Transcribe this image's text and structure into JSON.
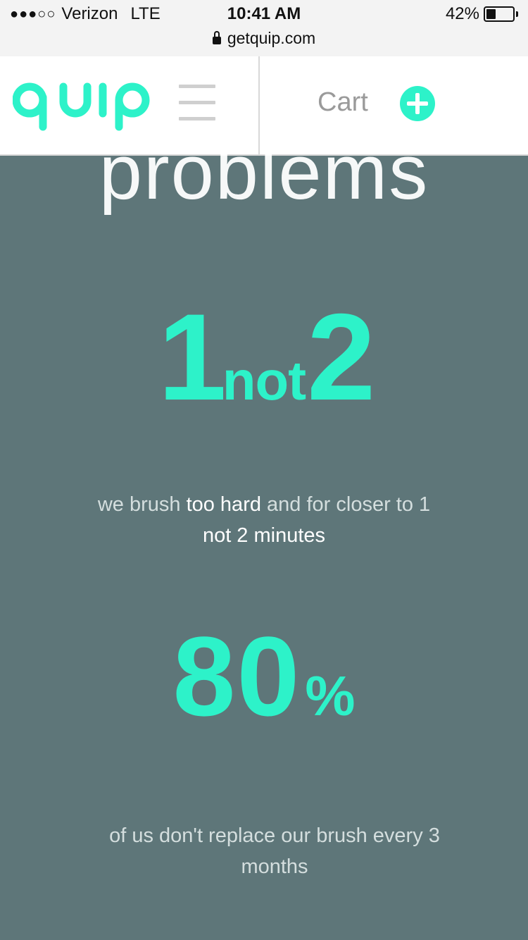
{
  "status_bar": {
    "signal": "●●●○○",
    "carrier": "Verizon",
    "network": "LTE",
    "time": "10:41 AM",
    "battery": "42%",
    "battery_level": 0.42
  },
  "url_bar": {
    "url": "getquip.com"
  },
  "header": {
    "logo_text": "quip",
    "cart_label": "Cart",
    "accent_color": "#2df2c9"
  },
  "main": {
    "heading": "problems",
    "stat1": {
      "first": "1",
      "middle": "not",
      "last": "2"
    },
    "desc1": {
      "pre": "we brush ",
      "highlight1": "too hard",
      "mid": " and for closer to 1 ",
      "highlight2": "not 2 minutes"
    },
    "stat2": {
      "value": "80",
      "unit": "%"
    },
    "desc2": "of us don't replace our brush every 3 months",
    "background_color": "#5e7679"
  }
}
